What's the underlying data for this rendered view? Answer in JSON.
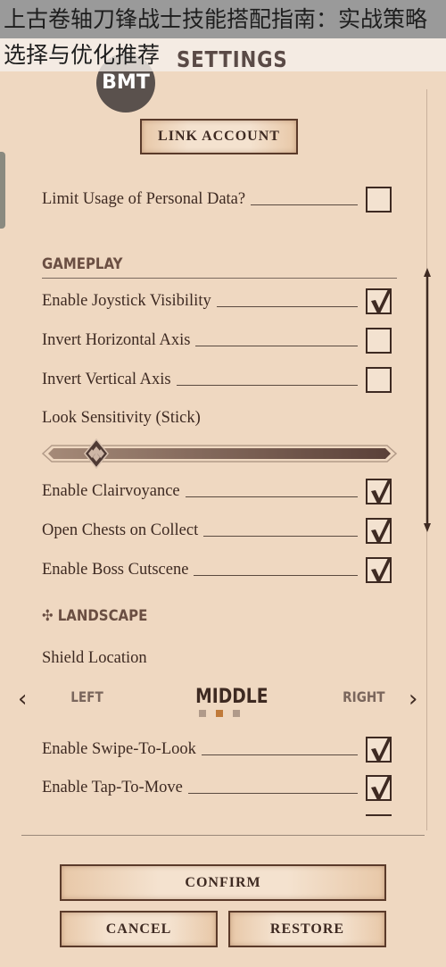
{
  "overlay_title": {
    "line1": "上古卷轴刀锋战士技能搭配指南：实战策略",
    "line2": "选择与优化推荐"
  },
  "header": {
    "title": "SETTINGS",
    "logo": "BMT"
  },
  "account": {
    "link_label": "LINK ACCOUNT",
    "privacy": {
      "label": "Limit Usage of Personal Data?",
      "checked": false
    }
  },
  "gameplay": {
    "heading": "GAMEPLAY",
    "items": [
      {
        "label": "Enable Joystick Visibility",
        "checked": true
      },
      {
        "label": "Invert Horizontal Axis",
        "checked": false
      },
      {
        "label": "Invert Vertical Axis",
        "checked": false
      }
    ],
    "sensitivity": {
      "label": "Look Sensitivity (Stick)",
      "value_percent": 14
    },
    "items2": [
      {
        "label": "Enable Clairvoyance",
        "checked": true
      },
      {
        "label": "Open Chests on Collect",
        "checked": true
      },
      {
        "label": "Enable Boss Cutscene",
        "checked": true
      }
    ]
  },
  "landscape": {
    "heading": "✣ LANDSCAPE",
    "shield_label": "Shield Location",
    "options": [
      "LEFT",
      "MIDDLE",
      "RIGHT"
    ],
    "selected": "MIDDLE",
    "items": [
      {
        "label": "Enable Swipe-To-Look",
        "checked": true
      },
      {
        "label": "Enable Tap-To-Move",
        "checked": true
      }
    ]
  },
  "footer": {
    "confirm": "CONFIRM",
    "cancel": "CANCEL",
    "restore": "RESTORE"
  },
  "colors": {
    "parchment": "#efd8c1",
    "ink": "#3e2a22",
    "accent_dot": "#c07a3a"
  }
}
